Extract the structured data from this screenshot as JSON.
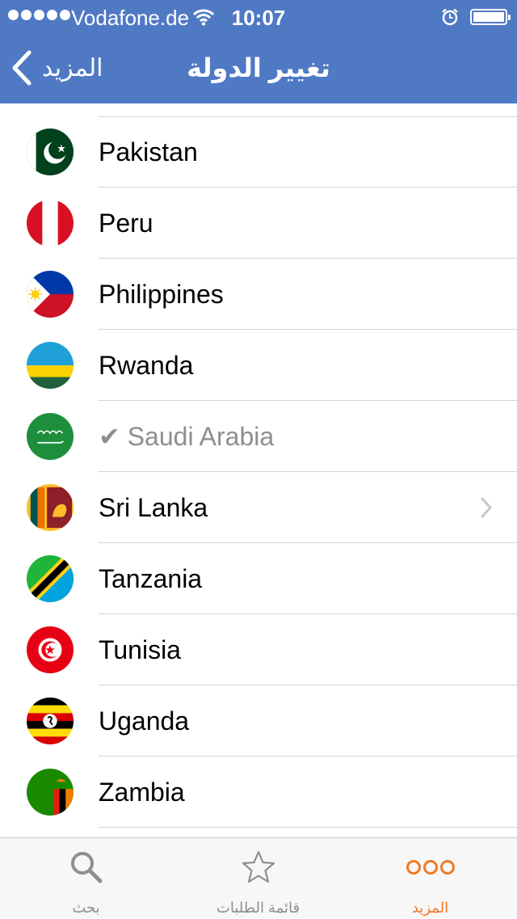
{
  "status_bar": {
    "carrier": "Vodafone.de",
    "time": "10:07"
  },
  "nav": {
    "back_label": "المزيد",
    "title": "تغيير الدولة"
  },
  "selected_mark": "✔",
  "countries": [
    {
      "name": "Pakistan",
      "flag": "pakistan-flag-icon"
    },
    {
      "name": "Peru",
      "flag": "peru-flag-icon"
    },
    {
      "name": "Philippines",
      "flag": "philippines-flag-icon"
    },
    {
      "name": "Rwanda",
      "flag": "rwanda-flag-icon"
    },
    {
      "name": "Saudi Arabia",
      "flag": "saudi-arabia-flag-icon",
      "selected": true
    },
    {
      "name": "Sri Lanka",
      "flag": "sri-lanka-flag-icon"
    },
    {
      "name": "Tanzania",
      "flag": "tanzania-flag-icon"
    },
    {
      "name": "Tunisia",
      "flag": "tunisia-flag-icon"
    },
    {
      "name": "Uganda",
      "flag": "uganda-flag-icon"
    },
    {
      "name": "Zambia",
      "flag": "zambia-flag-icon"
    }
  ],
  "tabs": [
    {
      "label": "بحث",
      "icon": "search-icon"
    },
    {
      "label": "قائمة الطلبات",
      "icon": "star-icon"
    },
    {
      "label": "المزيد",
      "icon": "more-icon",
      "active": true
    }
  ],
  "colors": {
    "nav_bar": "#5079c4",
    "accent": "#f07a22",
    "inactive_tab": "#8e8e93",
    "selected_text": "#8e8e93"
  }
}
